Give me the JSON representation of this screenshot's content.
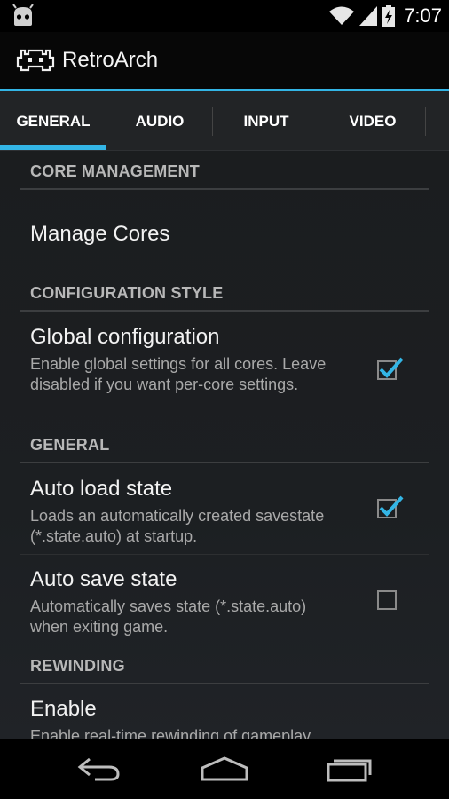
{
  "status_bar": {
    "time": "7:07",
    "icons": [
      "android-notification-icon",
      "wifi-icon",
      "signal-icon",
      "battery-icon"
    ]
  },
  "action_bar": {
    "title": "RetroArch",
    "logo": "retroarch-logo-icon"
  },
  "tabs": [
    {
      "label": "GENERAL",
      "selected": true
    },
    {
      "label": "AUDIO",
      "selected": false
    },
    {
      "label": "INPUT",
      "selected": false
    },
    {
      "label": "VIDEO",
      "selected": false
    }
  ],
  "sections": {
    "core_management": {
      "header": "CORE MANAGEMENT",
      "manage_cores": {
        "title": "Manage Cores"
      }
    },
    "configuration_style": {
      "header": "CONFIGURATION STYLE",
      "global_configuration": {
        "title": "Global configuration",
        "summary": "Enable global settings for all cores. Leave disabled if you want per-core settings.",
        "checked": true
      }
    },
    "general": {
      "header": "GENERAL",
      "auto_load_state": {
        "title": "Auto load state",
        "summary": "Loads an automatically created savestate (*.state.auto) at startup.",
        "checked": true
      },
      "auto_save_state": {
        "title": "Auto save state",
        "summary": "Automatically saves state (*.state.auto) when exiting game.",
        "checked": false
      }
    },
    "rewinding": {
      "header": "REWINDING",
      "enable": {
        "title": "Enable",
        "summary": "Enable real-time rewinding of gameplay."
      }
    }
  },
  "nav_bar": {
    "buttons": [
      "back-icon",
      "home-icon",
      "recent-apps-icon"
    ]
  },
  "colors": {
    "accent": "#33b5e5",
    "background": "#1c1f22",
    "section_header": "#b8b8b8",
    "summary_text": "#a9a9a9"
  }
}
